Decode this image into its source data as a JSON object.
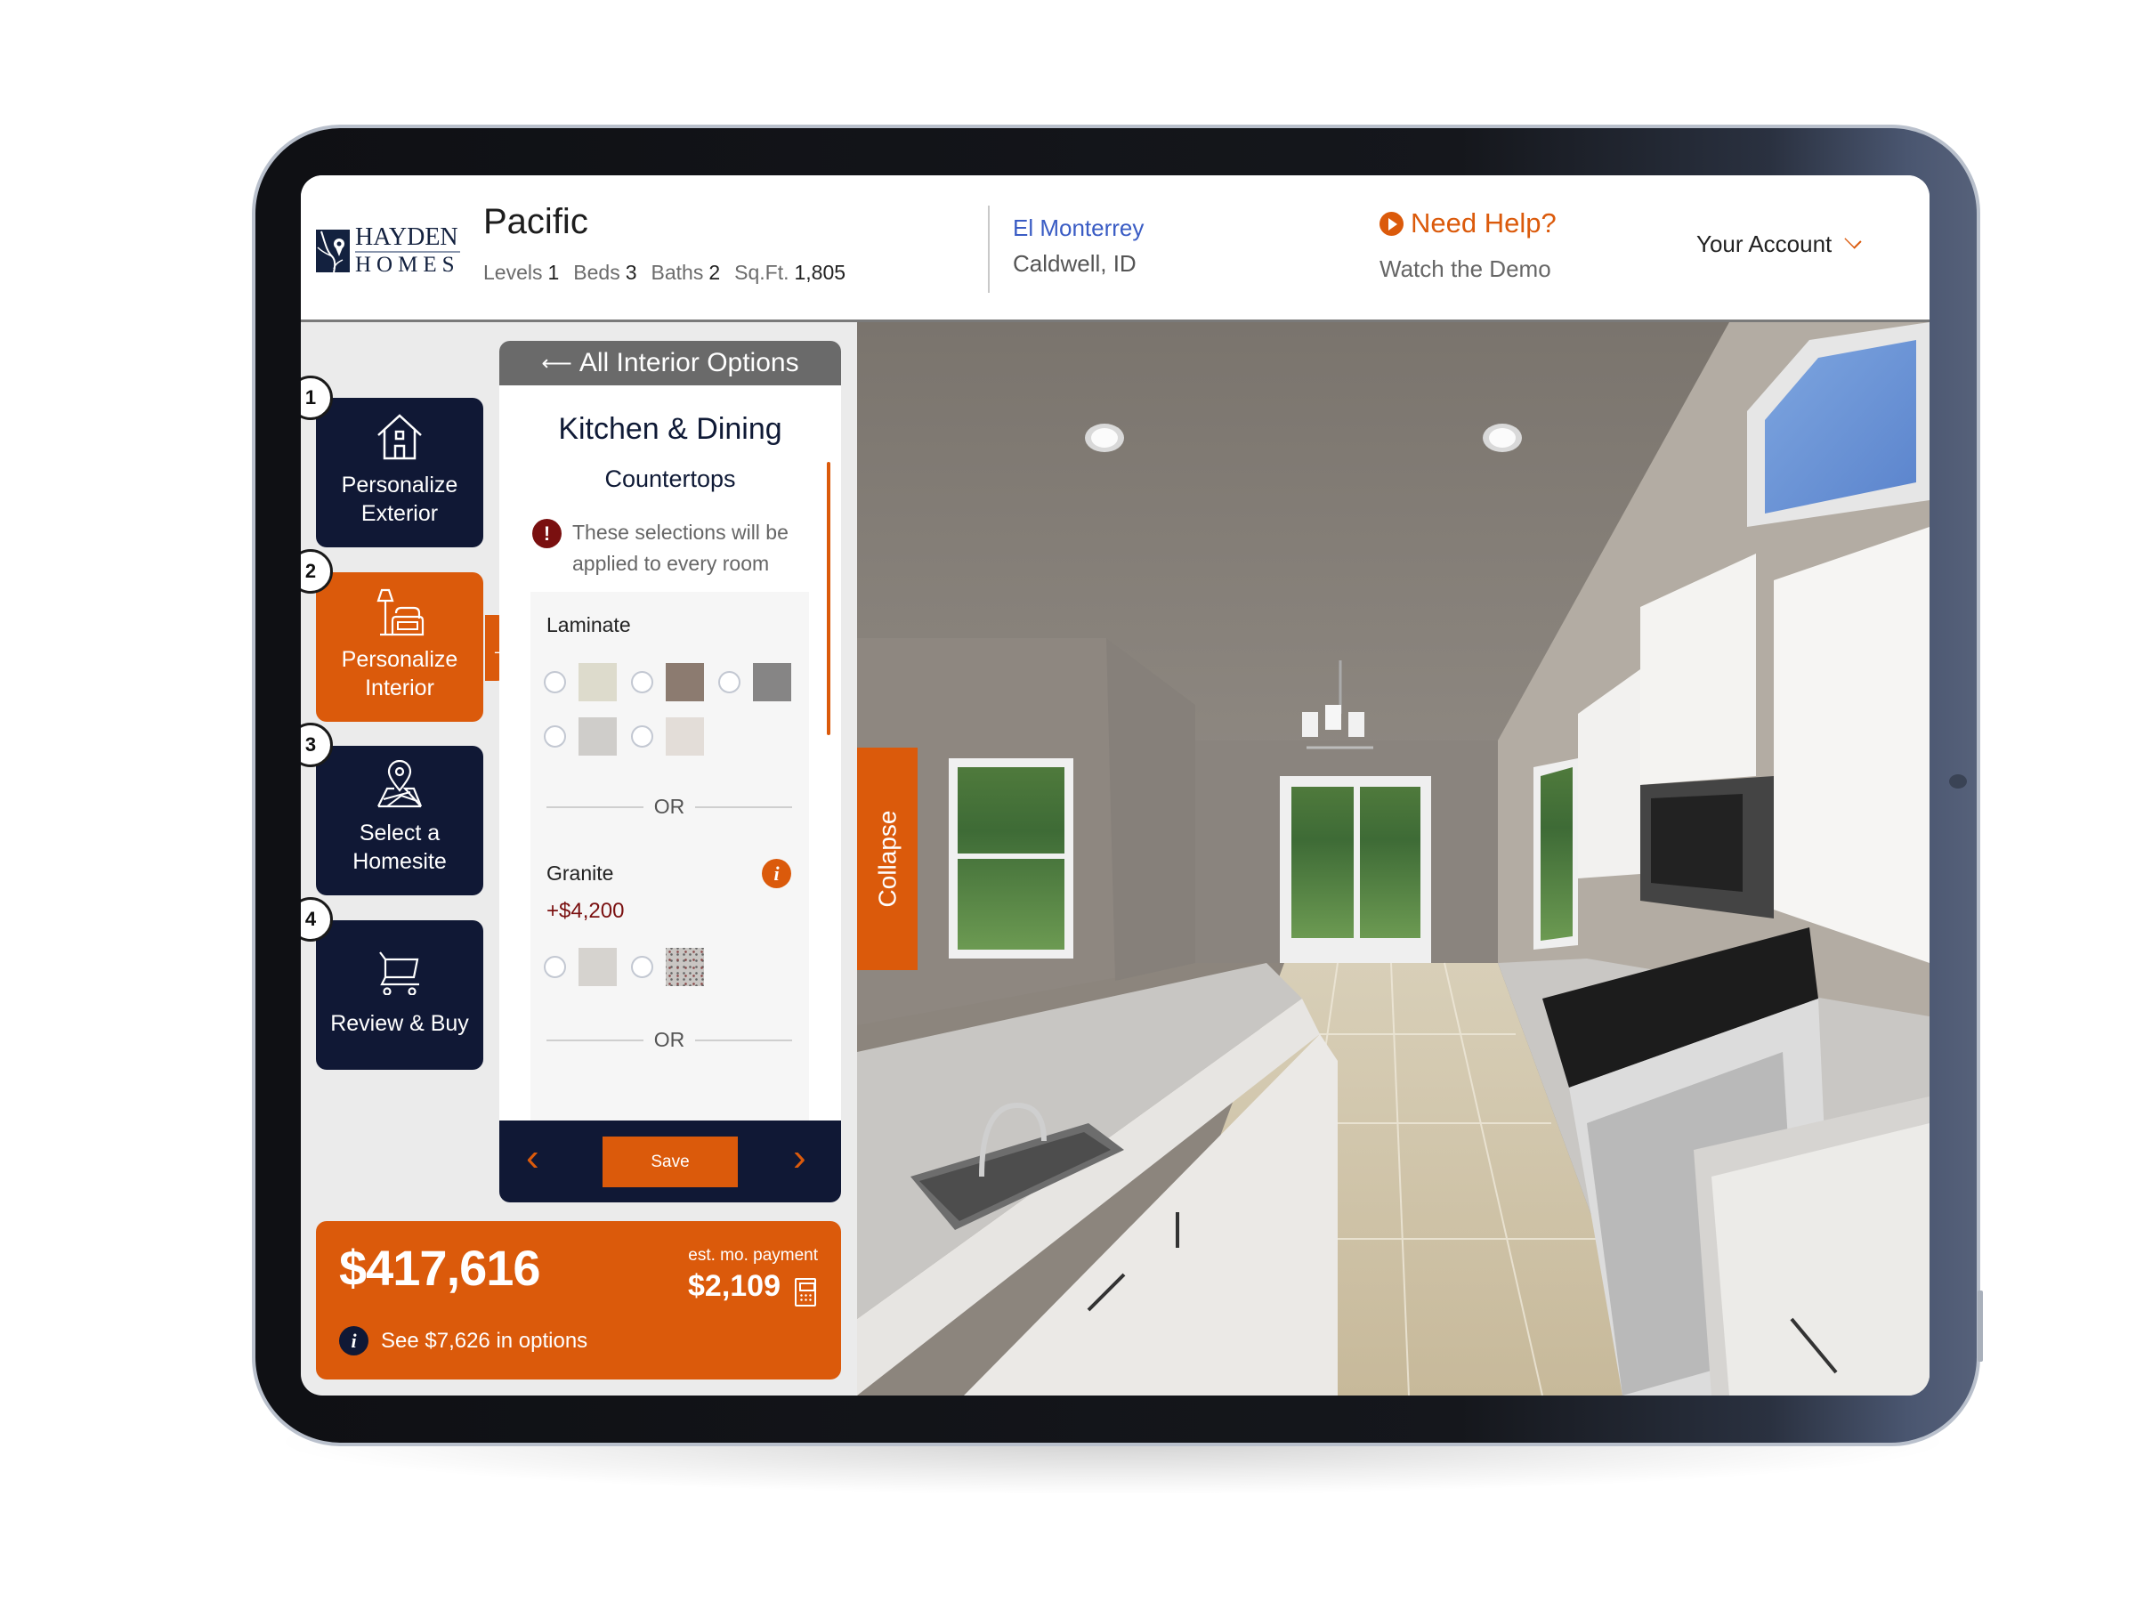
{
  "brand": {
    "logo_line1": "HAYDEN",
    "logo_line2": "HOMES"
  },
  "plan": {
    "name": "Pacific",
    "specs": [
      {
        "label": "Levels",
        "value": "1"
      },
      {
        "label": "Beds",
        "value": "3"
      },
      {
        "label": "Baths",
        "value": "2"
      },
      {
        "label": "Sq.Ft.",
        "value": "1,805"
      }
    ]
  },
  "location": {
    "community": "El Monterrey",
    "city": "Caldwell, ID"
  },
  "help": {
    "title": "Need Help?",
    "subtitle": "Watch the Demo"
  },
  "account": {
    "label": "Your Account"
  },
  "steps": [
    {
      "number": "1",
      "label_line1": "Personalize",
      "label_line2": "Exterior",
      "icon": "house-icon",
      "active": false
    },
    {
      "number": "2",
      "label_line1": "Personalize",
      "label_line2": "Interior",
      "icon": "lamp-chair-icon",
      "active": true
    },
    {
      "number": "3",
      "label_line1": "Select a",
      "label_line2": "Homesite",
      "icon": "map-pin-icon",
      "active": false
    },
    {
      "number": "4",
      "label_line1": "Review & Buy",
      "label_line2": "",
      "icon": "cart-icon",
      "active": false
    }
  ],
  "options_panel": {
    "back_label": "All Interior Options",
    "back_arrow": "⟵",
    "section_title": "Kitchen & Dining",
    "category": "Countertops",
    "notice": "These selections will be applied to every room",
    "groups": [
      {
        "name": "Laminate",
        "price": "",
        "swatches": [
          "#dddbcc",
          "#8c7b70",
          "#868585",
          "#cfcdca",
          "#e3ddd8"
        ]
      },
      {
        "name": "Granite",
        "price": "+$4,200",
        "swatches": [
          "#d6d3cf",
          "#c9c6c3"
        ]
      }
    ],
    "or_label": "OR",
    "save_label": "Save",
    "prev_icon": "‹",
    "next_icon": "›"
  },
  "pricing": {
    "total": "$417,616",
    "est_label": "est. mo. payment",
    "monthly": "$2,109",
    "options_text": "See $7,626 in options"
  },
  "viewer": {
    "collapse_label": "Collapse"
  },
  "colors": {
    "accent_orange": "#db5a0b",
    "navy": "#101835",
    "link_blue": "#3a5cc4",
    "price_red": "#7a1010"
  }
}
